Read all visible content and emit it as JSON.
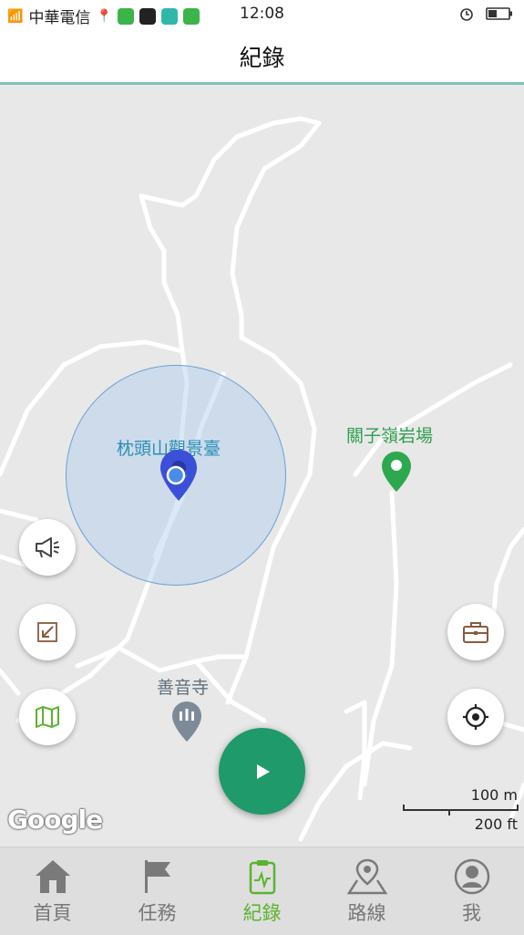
{
  "status_bar": {
    "carrier": "中華電信",
    "time": "12:08"
  },
  "header": {
    "title": "紀錄"
  },
  "map": {
    "pois": [
      {
        "name": "枕頭山觀景臺",
        "color": "#2a8fb5"
      },
      {
        "name": "關子嶺岩場",
        "color": "#2e9e4f"
      },
      {
        "name": "善音寺",
        "color": "#5f6f7d"
      }
    ],
    "attribution": "Google",
    "scale": {
      "metric": "100 m",
      "imperial": "200 ft"
    }
  },
  "buttons": {
    "announce_icon": "megaphone-icon",
    "import_icon": "arrow-in-icon",
    "map_icon": "folded-map-icon",
    "toolbox_icon": "briefcase-icon",
    "locate_icon": "crosshair-icon",
    "play_icon": "play-icon"
  },
  "tabs": [
    {
      "label": "首頁",
      "icon": "home-icon",
      "active": false
    },
    {
      "label": "任務",
      "icon": "flag-icon",
      "active": false
    },
    {
      "label": "紀錄",
      "icon": "clipboard-pulse-icon",
      "active": true
    },
    {
      "label": "路線",
      "icon": "map-pin-route-icon",
      "active": false
    },
    {
      "label": "我",
      "icon": "user-icon",
      "active": false
    }
  ],
  "colors": {
    "accent_green": "#5bb32e",
    "play_button": "#1f9a6a",
    "header_underline": "#7fc4b4",
    "location_blue": "#3b4fd8"
  }
}
